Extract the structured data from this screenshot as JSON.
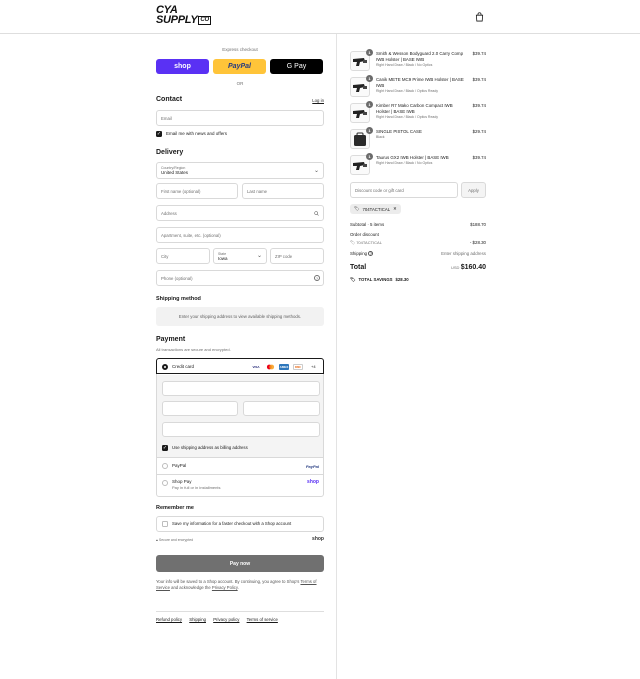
{
  "brand": {
    "logo_line1": "CYA",
    "logo_line2": "SUPPLY",
    "logo_co": "CO"
  },
  "express": {
    "title": "Express checkout",
    "shop_label": "shop",
    "paypal_label": "PayPal",
    "gpay_label": "G Pay",
    "or_label": "OR"
  },
  "contact": {
    "title": "Contact",
    "login_link": "Log in",
    "email_placeholder": "Email",
    "newsletter_label": "Email me with news and offers"
  },
  "delivery": {
    "title": "Delivery",
    "country_label": "Country/Region",
    "country_value": "United States",
    "first_name": "First name (optional)",
    "last_name": "Last name",
    "address": "Address",
    "apartment": "Apartment, suite, etc. (optional)",
    "city": "City",
    "state_label": "State",
    "state_value": "Iowa",
    "zip": "ZIP code",
    "phone": "Phone (optional)"
  },
  "shipping_method": {
    "title": "Shipping method",
    "info": "Enter your shipping address to view available shipping methods."
  },
  "payment": {
    "title": "Payment",
    "subtitle": "All transactions are secure and encrypted.",
    "credit_card_label": "Credit card",
    "card_brands": [
      "VISA",
      "MC",
      "AMEX",
      "DISC"
    ],
    "more_cards": "+4",
    "billing_same_label": "Use shipping address as billing address",
    "paypal_option": "PayPal",
    "paypal_logo": "PayPal",
    "shop_pay_option": "Shop Pay",
    "shop_pay_sub": "Pay in full or in installments",
    "shop_pay_logo": "shop"
  },
  "remember": {
    "title": "Remember me",
    "save_label": "Save my information for a faster checkout with a Shop account",
    "secure_text": "Secure and encrypted",
    "shop_logo": "shop"
  },
  "pay_now_label": "Pay now",
  "legal": {
    "line1": "Your info will be saved to a Shop account. By continuing, you agree to Shop's",
    "terms_link": "Terms of Service",
    "and_text": "and acknowledge the",
    "privacy_link": "Privacy Policy",
    "period": "."
  },
  "footer_links": [
    "Refund policy",
    "Shipping",
    "Privacy policy",
    "Terms of service"
  ],
  "cart": {
    "items": [
      {
        "qty": "1",
        "title": "Smith & Wesson Bodyguard 2.0 Carry Comp IWB Holster | BASE IWB",
        "sub": "Right Hand Draw / Black / No Optics",
        "price": "$39.74"
      },
      {
        "qty": "1",
        "title": "Canik METE MC9 Prime IWB Holster | BASE IWB",
        "sub": "Right Hand Draw / Black / Optics Ready",
        "price": "$39.74"
      },
      {
        "qty": "1",
        "title": "Kimber R7 Mako Carbon Compact IWB Holster | BASE IWB",
        "sub": "Right Hand Draw / Black / Optics Ready",
        "price": "$39.74"
      },
      {
        "qty": "1",
        "title": "SINGLE PISTOL CASE",
        "sub": "Black",
        "price": "$29.74"
      },
      {
        "qty": "1",
        "title": "Taurus GX2 IWB Holster | BASE IWB",
        "sub": "Right Hand Draw / Black / No Optics",
        "price": "$39.74"
      }
    ],
    "discount_placeholder": "Discount code or gift card",
    "apply_label": "Apply",
    "discount_tag": "704TACTICAL",
    "subtotal_label": "Subtotal · 5 items",
    "subtotal_value": "$188.70",
    "order_discount_label": "Order discount",
    "order_discount_code": "704TACTICAL",
    "order_discount_value": "- $28.30",
    "shipping_label": "Shipping",
    "shipping_value": "Enter shipping address",
    "total_label": "Total",
    "total_currency": "USD",
    "total_value": "$160.40",
    "savings_label": "TOTAL SAVINGS",
    "savings_value": "$28.30"
  },
  "colors": {
    "shop_purple": "#5a31f4",
    "paypal_yellow": "#ffc439",
    "pay_button": "#707070"
  }
}
